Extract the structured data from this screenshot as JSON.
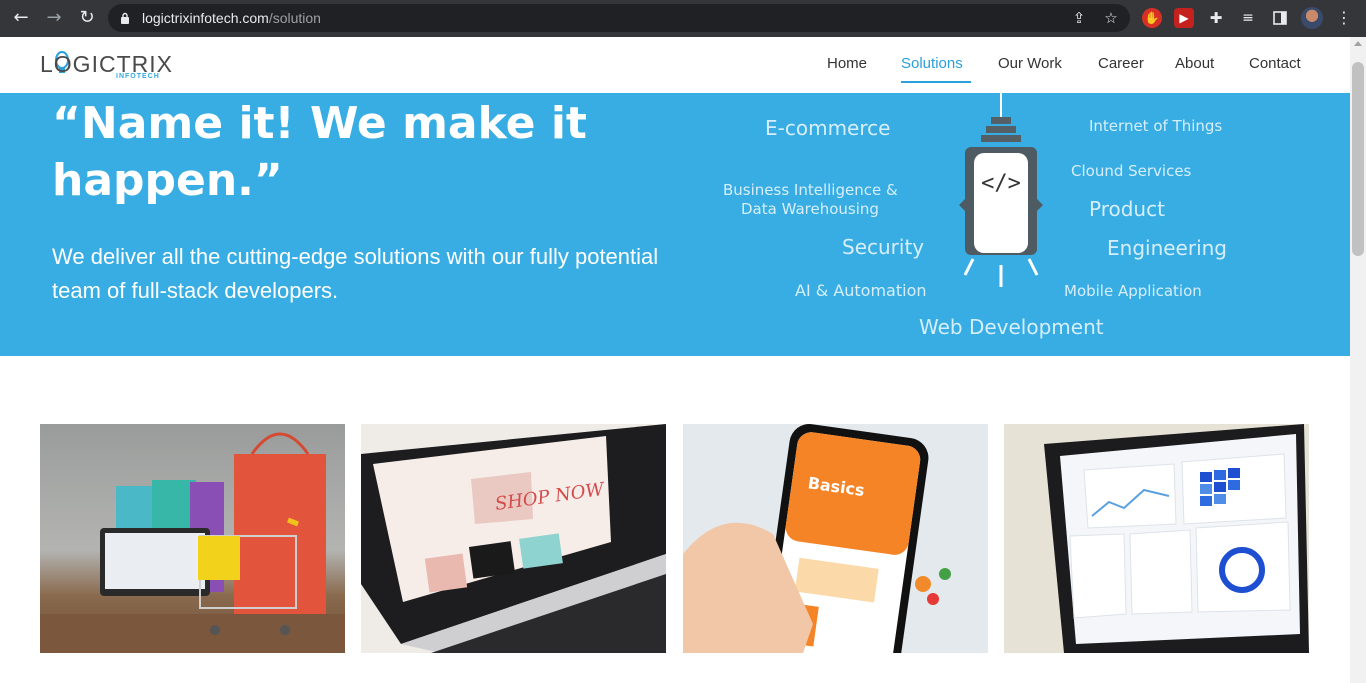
{
  "browser": {
    "url_host": "logictrixinfotech.com",
    "url_path": "/solution"
  },
  "header": {
    "logo_text": "LOGICTRIX",
    "logo_sub": "INFOTECH",
    "nav": [
      "Home",
      "Solutions",
      "Our Work",
      "Career",
      "About",
      "Contact"
    ],
    "active_nav": "Solutions",
    "accent_color": "#2a9fd8"
  },
  "hero": {
    "title": "“Name it! We make it happen.”",
    "subtitle": "We deliver all the cutting-edge solutions with our fully potential team of full-stack developers.",
    "background_color": "#38ade3",
    "tags": [
      "E-commerce",
      "Internet of Things",
      "Clound Services",
      "Business Intelligence &",
      "Data Warehousing",
      "Product",
      "Security",
      "Engineering",
      "AI & Automation",
      "Mobile Application",
      "Web Development"
    ]
  },
  "cards": [
    "shopping-cart-image",
    "ecommerce-laptop-image",
    "mobile-app-image",
    "analytics-dashboard-image"
  ]
}
